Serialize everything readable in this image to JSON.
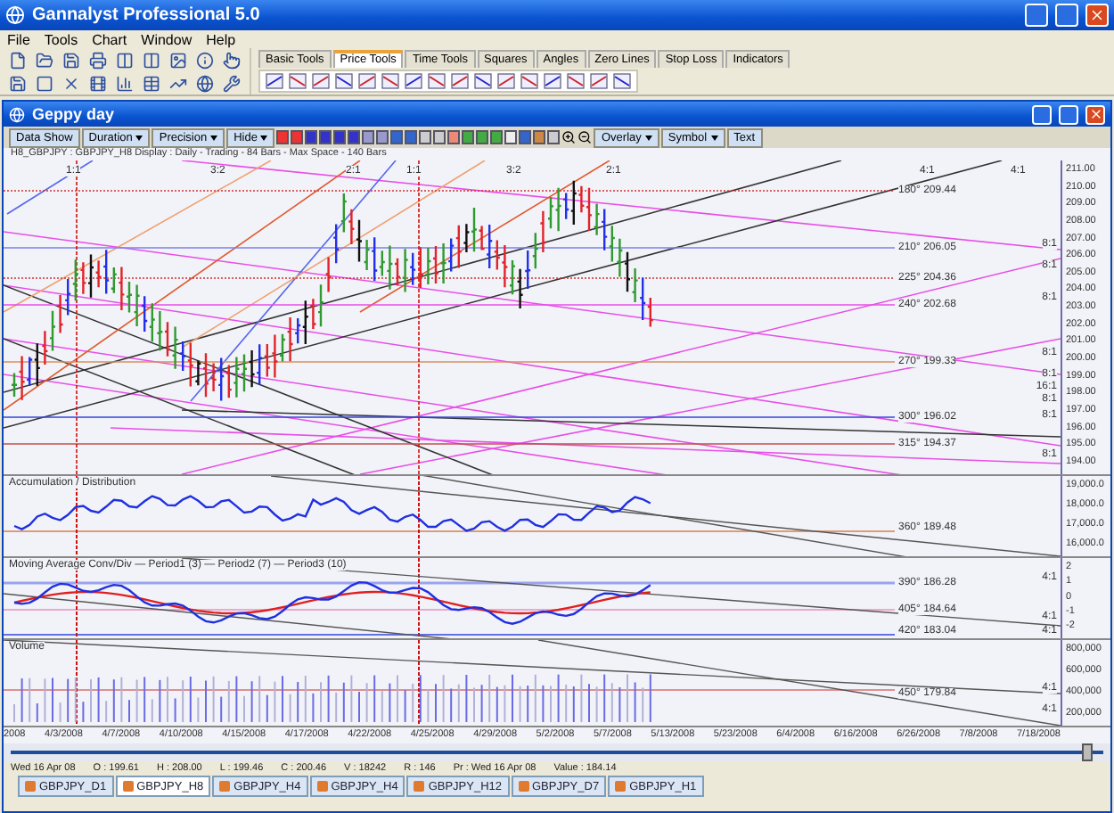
{
  "app_window": {
    "title": "Gannalyst Professional 5.0"
  },
  "menu": [
    "File",
    "Tools",
    "Chart",
    "Window",
    "Help"
  ],
  "tool_tabs": [
    {
      "label": "Basic Tools",
      "selected": false
    },
    {
      "label": "Price Tools",
      "selected": true
    },
    {
      "label": "Time Tools",
      "selected": false
    },
    {
      "label": "Squares",
      "selected": false
    },
    {
      "label": "Angles",
      "selected": false
    },
    {
      "label": "Zero Lines",
      "selected": false
    },
    {
      "label": "Stop Loss",
      "selected": false
    },
    {
      "label": "Indicators",
      "selected": false
    }
  ],
  "chart_window": {
    "title": "Geppy day"
  },
  "chart_toolbar": [
    {
      "label": "Data Show",
      "kind": "plain"
    },
    {
      "label": "Duration",
      "kind": "dropdown"
    },
    {
      "label": "Precision",
      "kind": "dropdown"
    },
    {
      "label": "Hide",
      "kind": "dropdown"
    },
    {
      "label": "Overlay",
      "kind": "dropdown"
    },
    {
      "label": "Symbol",
      "kind": "dropdown"
    },
    {
      "label": "Text",
      "kind": "plain"
    }
  ],
  "chart_header": "H8_GBPJPY : GBPJPY_H8 Display : Daily - Trading - 84 Bars - Max Space - 140 Bars",
  "main_chart": {
    "top_ratios": [
      "1:1",
      "3:2",
      "2:1",
      "1:1",
      "3:2",
      "2:1",
      "4:1",
      "4:1"
    ],
    "side_ratios": [
      "8:1",
      "8:1",
      "8:1",
      "8:1",
      "8:1",
      "16:1",
      "8:1",
      "8:1",
      "8:1"
    ],
    "levels": [
      "180° 209.44",
      "210° 206.05",
      "225° 204.36",
      "240° 202.68",
      "270° 199.33",
      "300° 196.02",
      "315° 194.37"
    ],
    "axis": [
      "211.00",
      "210.00",
      "209.00",
      "208.00",
      "207.00",
      "206.00",
      "205.00",
      "204.00",
      "203.00",
      "202.00",
      "201.00",
      "200.00",
      "199.00",
      "198.00",
      "197.00",
      "196.00",
      "195.00",
      "194.00"
    ]
  },
  "ad_panel": {
    "title": "Accumulation / Distribution",
    "levels": [
      "360° 189.48"
    ],
    "axis": [
      "19,000.0",
      "18,000.0",
      "17,000.0",
      "16,000.0"
    ]
  },
  "macd_panel": {
    "title": "Moving Average Conv/Div — Period1 (3) — Period2 (7) — Period3 (10)",
    "levels": [
      "390° 186.28",
      "405° 184.64",
      "420° 183.04"
    ],
    "side_ratios": [
      "4:1",
      "4:1",
      "4:1"
    ],
    "axis": [
      "2",
      "1",
      "0",
      "-1",
      "-2"
    ]
  },
  "volume_panel": {
    "title": "Volume",
    "levels": [
      "450° 179.84"
    ],
    "side_ratios": [
      "4:1",
      "4:1"
    ],
    "axis": [
      "800,000",
      "600,000",
      "400,000",
      "200,000"
    ]
  },
  "dates": [
    "2008",
    "4/3/2008",
    "4/7/2008",
    "4/10/2008",
    "4/15/2008",
    "4/17/2008",
    "4/22/2008",
    "4/25/2008",
    "4/29/2008",
    "5/2/2008",
    "5/7/2008",
    "5/13/2008",
    "5/23/2008",
    "6/4/2008",
    "6/16/2008",
    "6/26/2008",
    "7/8/2008",
    "7/18/2008"
  ],
  "status": [
    "Wed 16 Apr 08",
    "O : 199.61",
    "H : 208.00",
    "L : 199.46",
    "C : 200.46",
    "V : 18242",
    "R : 146",
    "Pr : Wed 16 Apr 08",
    "Value : 184.14"
  ],
  "sheet_tabs": [
    {
      "label": "GBPJPY_D1",
      "selected": false
    },
    {
      "label": "GBPJPY_H8",
      "selected": true
    },
    {
      "label": "GBPJPY_H4",
      "selected": false
    },
    {
      "label": "GBPJPY_H4",
      "selected": false
    },
    {
      "label": "GBPJPY_H12",
      "selected": false
    },
    {
      "label": "GBPJPY_D7",
      "selected": false
    },
    {
      "label": "GBPJPY_H1",
      "selected": false
    }
  ]
}
